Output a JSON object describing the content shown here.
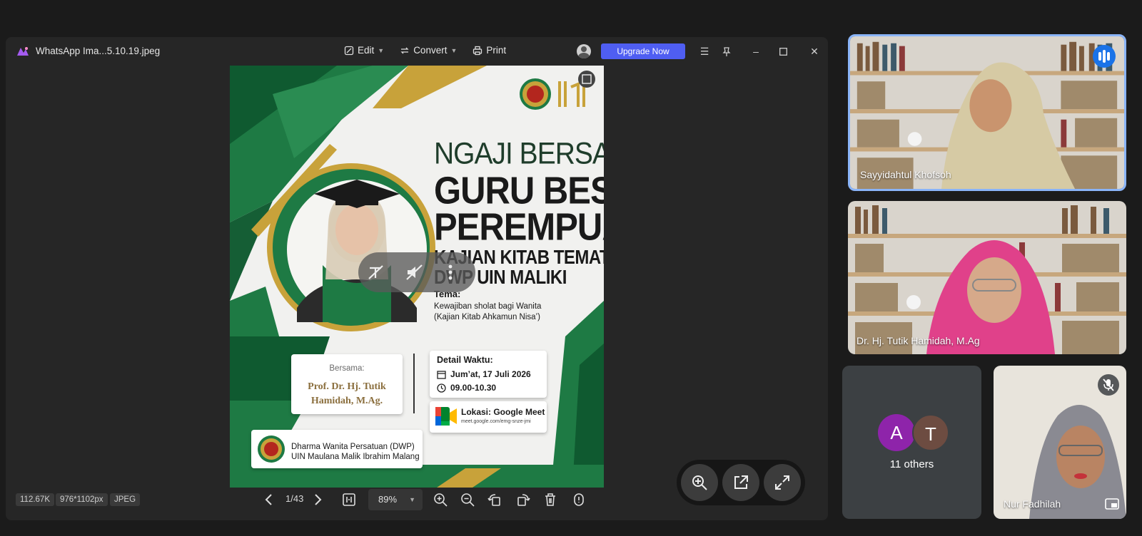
{
  "viewer": {
    "title": "WhatsApp Ima...5.10.19.jpeg",
    "toolbar": {
      "edit": "Edit",
      "convert": "Convert",
      "print": "Print",
      "upgrade": "Upgrade Now"
    },
    "status": {
      "size": "112.67K",
      "dimensions": "976*1102px",
      "format": "JPEG",
      "page": "1/43",
      "zoom": "89%"
    }
  },
  "poster": {
    "line1": "NGAJI BERSAMA",
    "line2": "GURU BESAR",
    "line3": "PEREMPUAN",
    "line4": "KAJIAN KITAB TEMATIK",
    "line5": "DWP UIN MALIKI",
    "tema_label": "Tema:",
    "tema_line1": "Kewajiban sholat bagi Wanita",
    "tema_line2": "(Kajian Kitab Ahkamun Nisa’)",
    "bersama_label": "Bersama:",
    "bersama_name1": "Prof. Dr. Hj. Tutik",
    "bersama_name2": "Hamidah, M.Ag.",
    "waktu_label": "Detail Waktu:",
    "waktu_date": "Jum’at, 17 Juli 2026",
    "waktu_time": "09.00-10.30",
    "lokasi_label": "Lokasi: Google Meet",
    "lokasi_url": "meet.google.com/emg-snze-jmi",
    "org_line1": "Dharma Wanita Persatuan (DWP)",
    "org_line2": "UIN Maulana Malik Ibrahim Malang"
  },
  "meeting": {
    "participants": [
      {
        "name": "Sayyidahtul Khofsoh"
      },
      {
        "name": "Dr. Hj. Tutik Hamidah, M.Ag"
      },
      {
        "name": "Nur Fadhilah"
      }
    ],
    "others": {
      "initials": [
        "A",
        "T"
      ],
      "label": "11 others"
    }
  },
  "colors": {
    "accent": "#4f5ef2",
    "poster_green": "#1e7a44",
    "gold": "#c8a23a",
    "speaker_border": "#8ab4f8",
    "avatar_a": "#8e24aa",
    "avatar_t": "#6d4c41"
  },
  "icons": [
    "app-logo-icon",
    "edit-icon",
    "convert-icon",
    "print-icon",
    "menu-icon",
    "pin-icon",
    "minimize-icon",
    "maximize-icon",
    "close-icon",
    "prev-page-icon",
    "next-page-icon",
    "fit-page-icon",
    "zoom-in-icon",
    "zoom-out-icon",
    "rotate-left-icon",
    "rotate-right-icon",
    "delete-icon",
    "info-icon",
    "speaking-icon",
    "mic-off-icon",
    "pip-icon"
  ]
}
